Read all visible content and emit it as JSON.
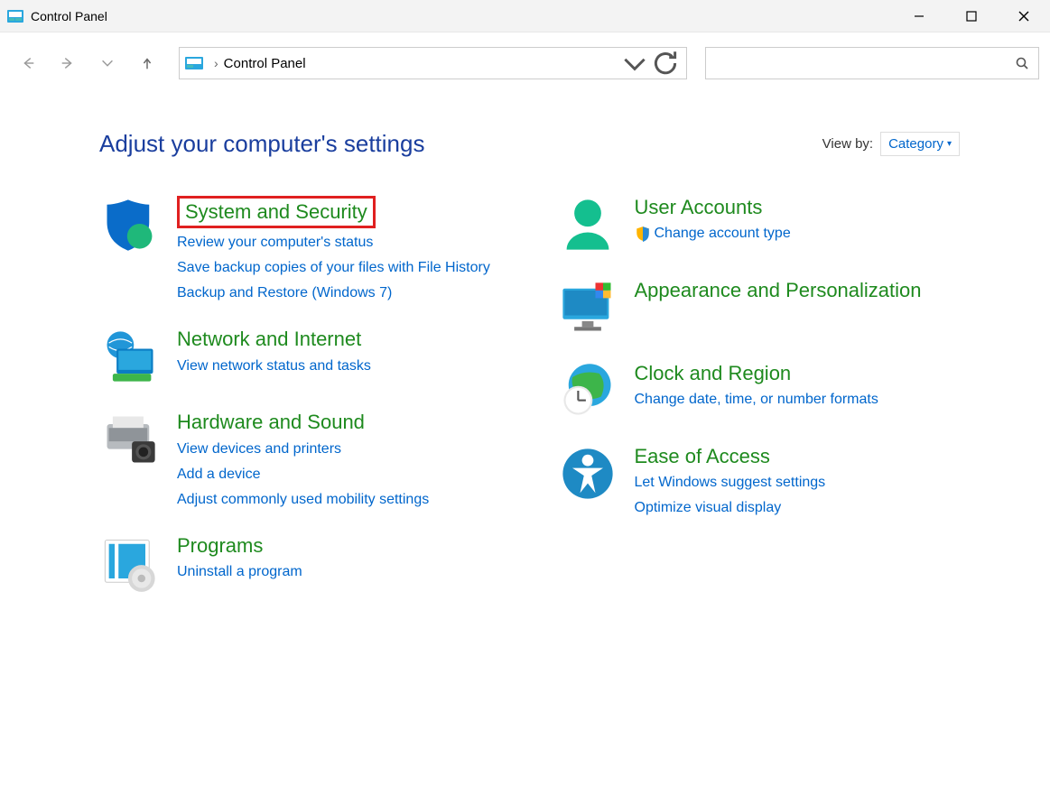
{
  "window": {
    "title": "Control Panel"
  },
  "addressbar": {
    "path": "Control Panel"
  },
  "header": {
    "title": "Adjust your computer's settings"
  },
  "viewby": {
    "label": "View by:",
    "value": "Category"
  },
  "left": [
    {
      "title": "System and Security",
      "highlight": true,
      "links": [
        "Review your computer's status",
        "Save backup copies of your files with File History",
        "Backup and Restore (Windows 7)"
      ]
    },
    {
      "title": "Network and Internet",
      "links": [
        "View network status and tasks"
      ]
    },
    {
      "title": "Hardware and Sound",
      "links": [
        "View devices and printers",
        "Add a device",
        "Adjust commonly used mobility settings"
      ]
    },
    {
      "title": "Programs",
      "links": [
        "Uninstall a program"
      ]
    }
  ],
  "right": [
    {
      "title": "User Accounts",
      "links": [
        {
          "text": "Change account type",
          "shield": true
        }
      ]
    },
    {
      "title": "Appearance and Personalization",
      "links": []
    },
    {
      "title": "Clock and Region",
      "links": [
        "Change date, time, or number formats"
      ]
    },
    {
      "title": "Ease of Access",
      "links": [
        "Let Windows suggest settings",
        "Optimize visual display"
      ]
    }
  ]
}
